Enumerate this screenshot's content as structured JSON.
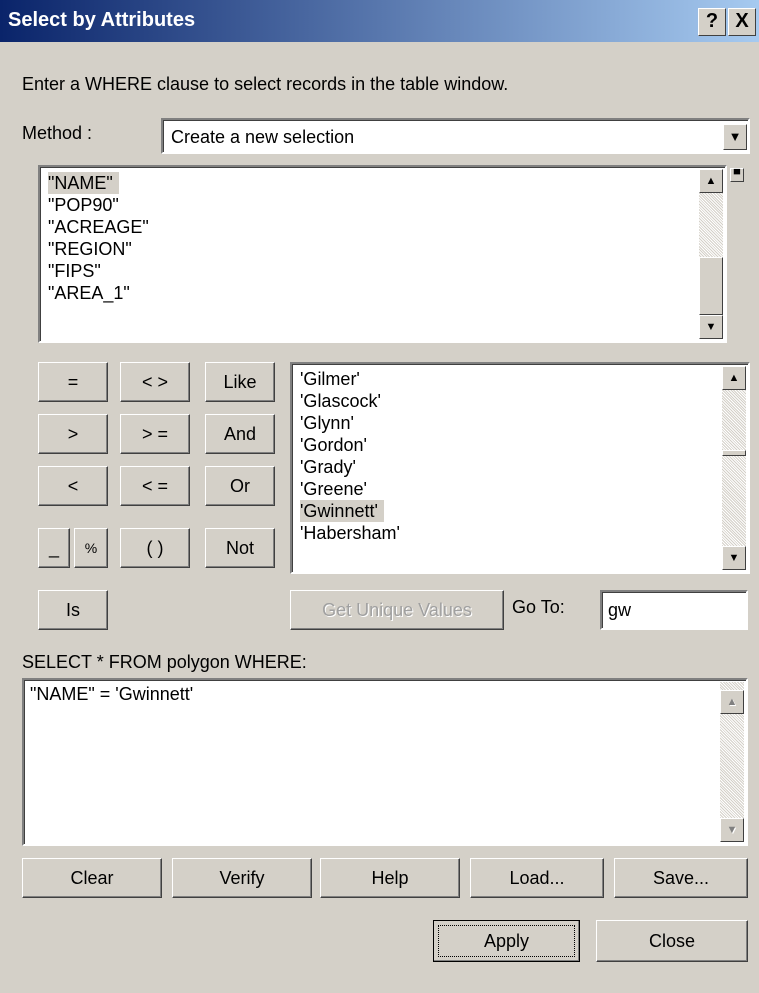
{
  "window": {
    "title": "Select by Attributes",
    "help_glyph": "?",
    "close_glyph": "X"
  },
  "instructions": "Enter a WHERE clause to select records in the table window.",
  "method": {
    "label": "Method :",
    "value": "Create a new selection"
  },
  "fields": {
    "items": [
      "\"NAME\"",
      "\"POP90\"",
      "\"ACREAGE\"",
      "\"REGION\"",
      "\"FIPS\"",
      "\"AREA_1\""
    ],
    "selected_index": 0
  },
  "operators": {
    "eq": "=",
    "ne": "< >",
    "like": "Like",
    "gt": ">",
    "ge": "> =",
    "and": "And",
    "lt": "<",
    "le": "< =",
    "or": "Or",
    "underscore": "_",
    "percent": "%",
    "parens": "( )",
    "not": "Not",
    "is": "Is"
  },
  "values": {
    "items": [
      "'Gilmer'",
      "'Glascock'",
      "'Glynn'",
      "'Gordon'",
      "'Grady'",
      "'Greene'",
      "'Gwinnett'",
      "'Habersham'"
    ],
    "selected_index": 6
  },
  "unique_button": "Get Unique Values",
  "goto": {
    "label": "Go To:",
    "value": "gw"
  },
  "where_label": "SELECT * FROM polygon WHERE:",
  "expression": "\"NAME\" = 'Gwinnett'",
  "buttons": {
    "clear": "Clear",
    "verify": "Verify",
    "help": "Help",
    "load": "Load...",
    "save": "Save...",
    "apply": "Apply",
    "close": "Close"
  },
  "colors": {
    "titlebar_start": "#0a246a",
    "titlebar_end": "#a6caf0",
    "dialog_bg": "#d4d0c8"
  }
}
